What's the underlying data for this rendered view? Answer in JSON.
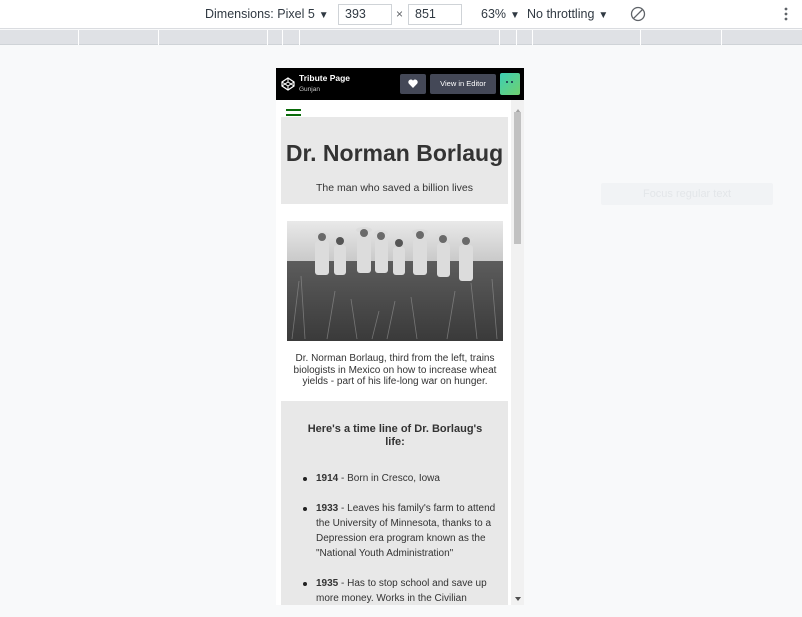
{
  "devtools": {
    "dimensions_label": "Dimensions: Pixel 5",
    "width": "393",
    "height": "851",
    "x_sep": "×",
    "zoom": "63%",
    "throttling": "No throttling",
    "faded_tip": "Focus regular text"
  },
  "codepen": {
    "title": "Tribute Page",
    "author": "Gunjan",
    "view_in_editor": "View in Editor"
  },
  "page": {
    "title": "Dr. Norman Borlaug",
    "subtitle": "The man who saved a billion lives",
    "caption": "Dr. Norman Borlaug, third from the left, trains biologists in Mexico on how to increase wheat yields - part of his life-long war on hunger.",
    "timeline_heading": "Here's a time line of Dr. Borlaug's life:",
    "timeline": [
      {
        "year": "1914",
        "text": " - Born in Cresco, Iowa"
      },
      {
        "year": "1933",
        "text": " - Leaves his family's farm to attend the University of Minnesota, thanks to a Depression era program known as the \"National Youth Administration\""
      },
      {
        "year": "1935",
        "text": " - Has to stop school and save up more money. Works in the Civilian"
      }
    ]
  },
  "colors": {
    "menu_icon": "#0a6b0a",
    "section_bg": "#e8e8e8",
    "codepen_header": "#000000"
  }
}
